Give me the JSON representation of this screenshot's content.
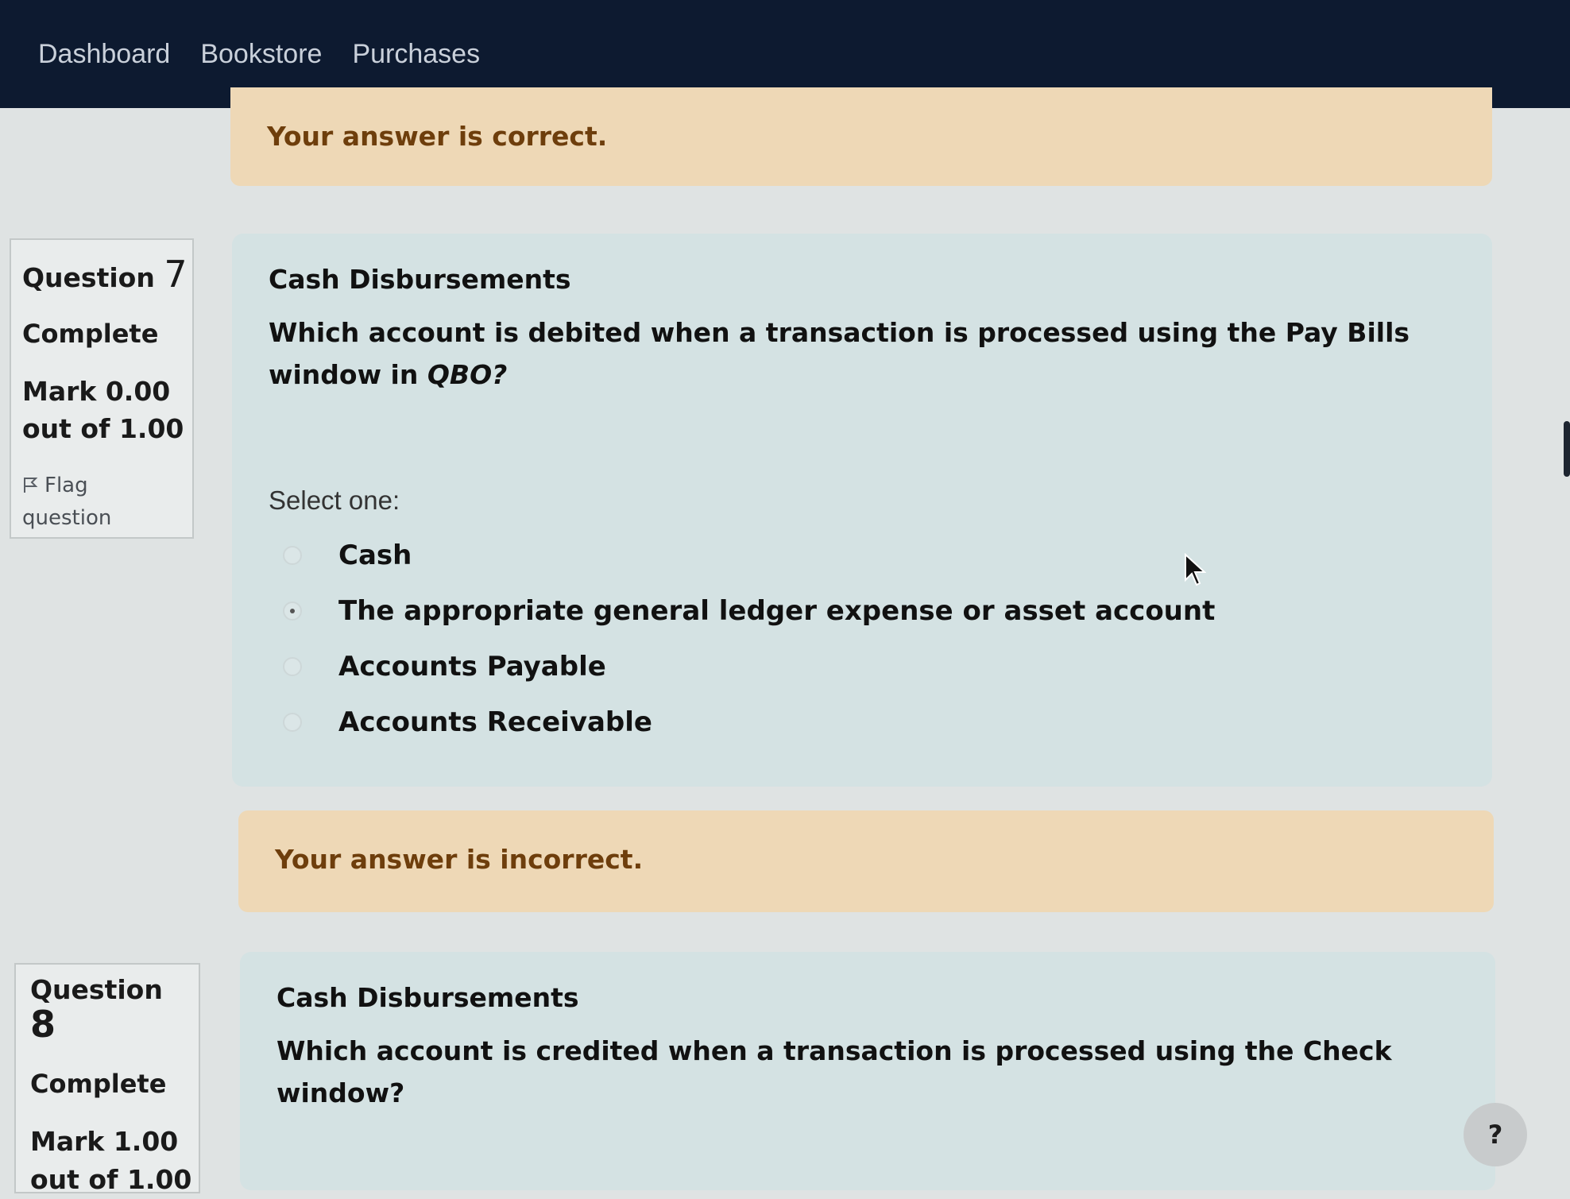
{
  "nav": {
    "items": [
      "Dashboard",
      "Bookstore",
      "Purchases"
    ]
  },
  "feedback_top": "Your answer is correct.",
  "question7": {
    "label": "Question",
    "number": "7",
    "state": "Complete",
    "mark_line1": "Mark 0.00",
    "mark_line2": "out of 1.00",
    "flag_label1": "Flag",
    "flag_label2": "question",
    "heading": "Cash Disbursements",
    "text_main": "Which account is debited when a transaction is processed using the Pay Bills window in ",
    "text_em": "QBO?",
    "select_prompt": "Select one:",
    "options": [
      {
        "label": "Cash",
        "checked": false
      },
      {
        "label": "The appropriate general ledger expense or asset account",
        "checked": true
      },
      {
        "label": "Accounts Payable",
        "checked": false
      },
      {
        "label": "Accounts Receivable",
        "checked": false
      }
    ]
  },
  "feedback_q7": "Your answer is incorrect.",
  "question8": {
    "label": "Question",
    "number": "8",
    "state": "Complete",
    "mark_line1": "Mark 1.00",
    "mark_line2": "out of 1.00",
    "heading": "Cash Disbursements",
    "text": "Which account is credited when a transaction is processed using the Check window?"
  },
  "help_label": "?",
  "colors": {
    "navbar": "#0d1a30",
    "feedback_bg": "#eed8b6",
    "feedback_text": "#6e3e0c",
    "question_bg": "#d4e2e3"
  }
}
